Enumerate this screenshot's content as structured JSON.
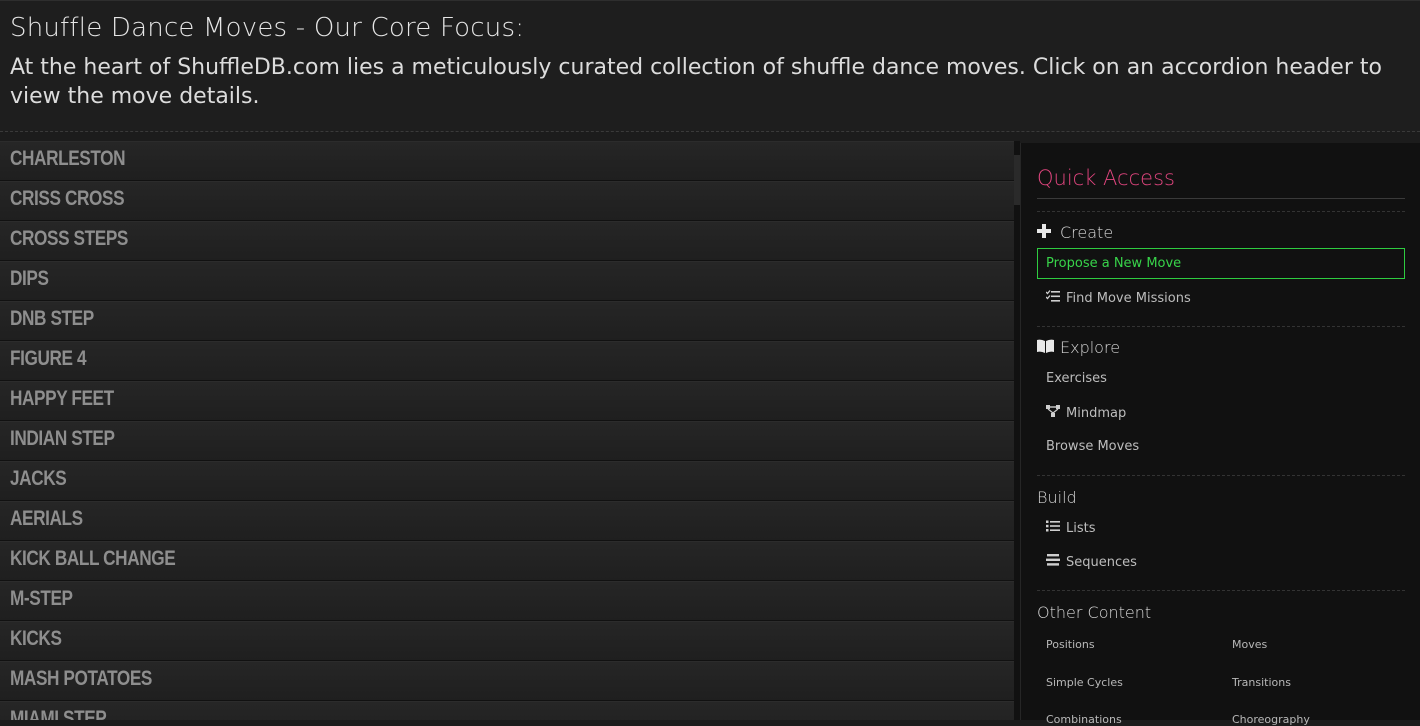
{
  "header": {
    "title": "Shuffle Dance Moves - Our Core Focus:",
    "intro": "At the heart of ShuffleDB.com lies a meticulously curated collection of shuffle dance moves. Click on an accordion header to view the move details."
  },
  "accordion": {
    "items": [
      "Charleston",
      "Criss Cross",
      "Cross Steps",
      "Dips",
      "DnB Step",
      "Figure 4",
      "Happy Feet",
      "Indian Step",
      "Jacks",
      "Aerials",
      "Kick Ball Change",
      "M-Step",
      "Kicks",
      "Mash Potatoes",
      "Miami Step"
    ]
  },
  "sidebar": {
    "title": "Quick Access",
    "create": {
      "heading": "Create",
      "icon": "plus-icon",
      "propose": "Propose a New Move",
      "missions": "Find Move Missions"
    },
    "explore": {
      "heading": "Explore",
      "icon": "book-icon",
      "exercises": "Exercises",
      "mindmap": "Mindmap",
      "browse": "Browse Moves"
    },
    "build": {
      "heading": "Build",
      "lists": "Lists",
      "sequences": "Sequences"
    },
    "other": {
      "heading": "Other Content",
      "links": [
        "Positions",
        "Moves",
        "Simple Cycles",
        "Transitions",
        "Combinations",
        "Choreography"
      ]
    },
    "colors": {
      "accent": "#e0457e",
      "propose": "#2ecc40"
    }
  }
}
